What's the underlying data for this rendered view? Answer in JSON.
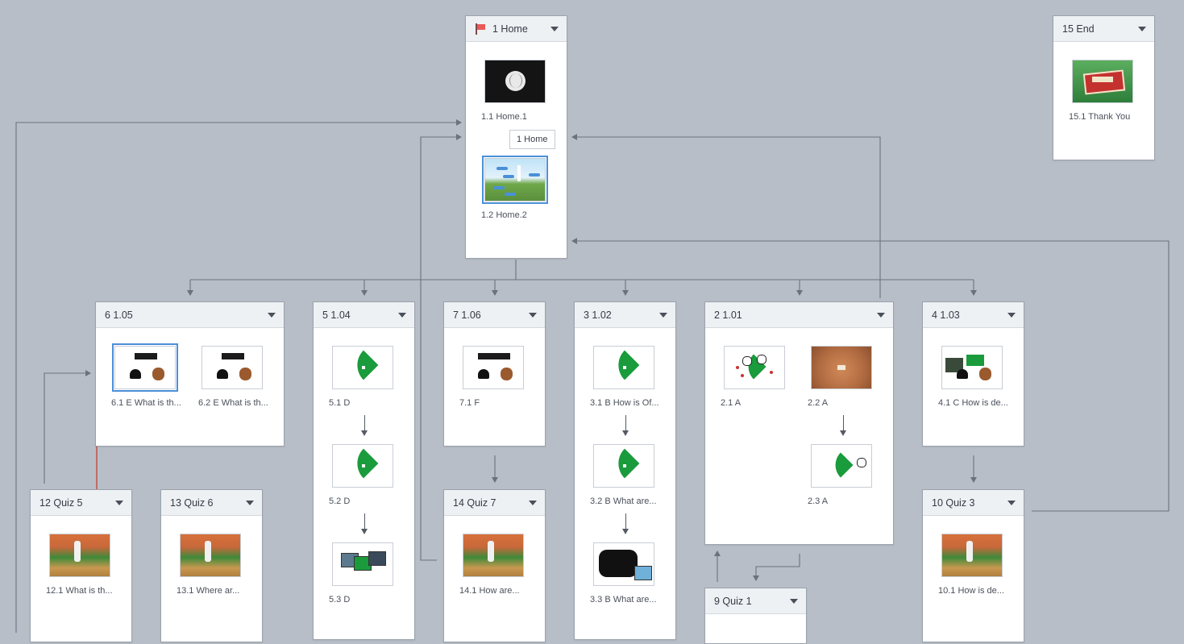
{
  "scenes": {
    "home": {
      "title": "1 Home",
      "slides": [
        "1.1 Home.1",
        "1.2 Home.2"
      ],
      "tooltip": "1 Home"
    },
    "end": {
      "title": "15 End",
      "slides": [
        "15.1 Thank You"
      ]
    },
    "s6": {
      "title": "6 1.05",
      "slides": [
        "6.1 E What is th...",
        "6.2 E What is th..."
      ]
    },
    "s5": {
      "title": "5 1.04",
      "slides": [
        "5.1 D",
        "5.2 D",
        "5.3 D"
      ]
    },
    "s7": {
      "title": "7 1.06",
      "slides": [
        "7.1 F"
      ]
    },
    "s3": {
      "title": "3 1.02",
      "slides": [
        "3.1 B How is Of...",
        "3.2 B What are...",
        "3.3 B What are..."
      ]
    },
    "s2": {
      "title": "2 1.01",
      "slides": [
        "2.1 A",
        "2.2 A",
        "2.3 A"
      ]
    },
    "s4": {
      "title": "4 1.03",
      "slides": [
        "4.1 C How is de..."
      ]
    },
    "q5": {
      "title": "12 Quiz 5",
      "slides": [
        "12.1  What is th..."
      ]
    },
    "q6": {
      "title": "13 Quiz 6",
      "slides": [
        "13.1  Where ar..."
      ]
    },
    "q7": {
      "title": "14 Quiz 7",
      "slides": [
        "14.1  How are..."
      ]
    },
    "q1": {
      "title": "9 Quiz 1"
    },
    "q3": {
      "title": "10 Quiz 3",
      "slides": [
        "10.1  How is de..."
      ]
    }
  },
  "icons": {
    "start_flag": "flag-icon",
    "menu": "caret-down-icon"
  },
  "colors": {
    "canvas": "#b8bec7",
    "connector": "#6b727c",
    "highlight_connector": "#c0392b",
    "selection": "#4a90d9"
  }
}
